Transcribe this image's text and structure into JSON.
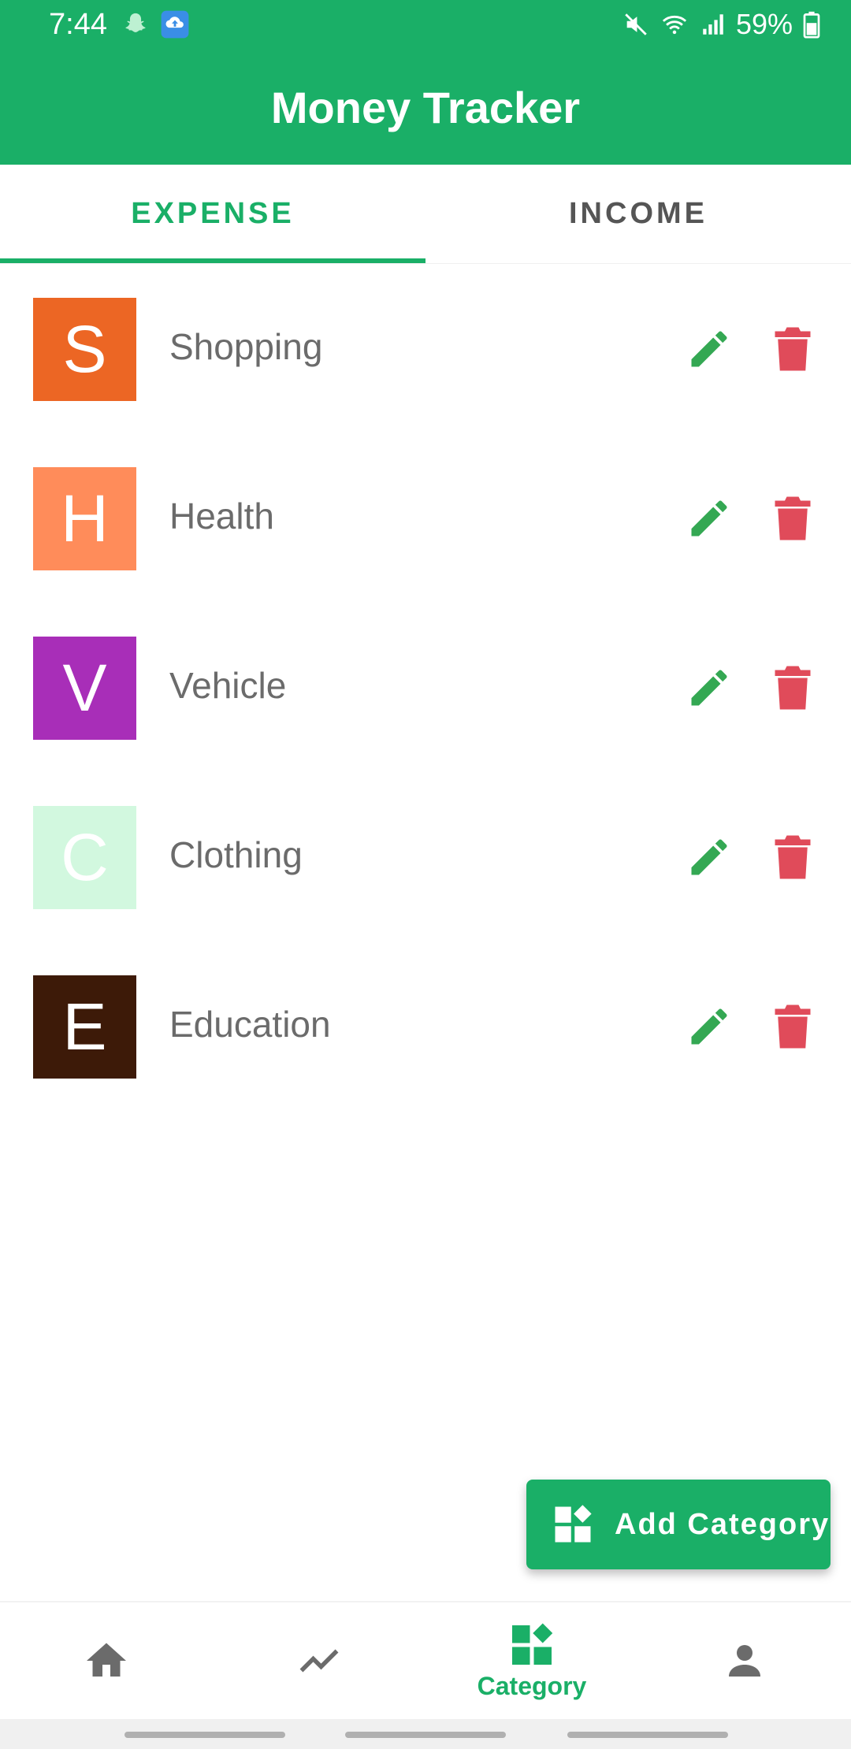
{
  "status_bar": {
    "time": "7:44",
    "battery": "59%",
    "left_icons": [
      "snapchat-icon",
      "cloud-upload-icon"
    ],
    "right_icons": [
      "mute-icon",
      "wifi-icon",
      "signal-icon",
      "battery-icon"
    ]
  },
  "header": {
    "title": "Money Tracker"
  },
  "tabs": [
    {
      "label": "EXPENSE",
      "active": true
    },
    {
      "label": "INCOME",
      "active": false
    }
  ],
  "categories": [
    {
      "letter": "S",
      "name": "Shopping",
      "color": "#ec6624"
    },
    {
      "letter": "H",
      "name": "Health",
      "color": "#ff8c5a"
    },
    {
      "letter": "V",
      "name": "Vehicle",
      "color": "#a82eb8"
    },
    {
      "letter": "C",
      "name": "Clothing",
      "color": "#d2f8df"
    },
    {
      "letter": "E",
      "name": "Education",
      "color": "#3d1a08"
    }
  ],
  "fab": {
    "label": "Add Category"
  },
  "bottom_nav": [
    {
      "icon": "home-icon",
      "label": "",
      "active": false
    },
    {
      "icon": "trend-icon",
      "label": "",
      "active": false
    },
    {
      "icon": "category-icon",
      "label": "Category",
      "active": true
    },
    {
      "icon": "person-icon",
      "label": "",
      "active": false
    }
  ],
  "colors": {
    "primary": "#1aaf67",
    "edit": "#34a853",
    "delete": "#e04b5a",
    "inactive": "#6b6b6b"
  }
}
